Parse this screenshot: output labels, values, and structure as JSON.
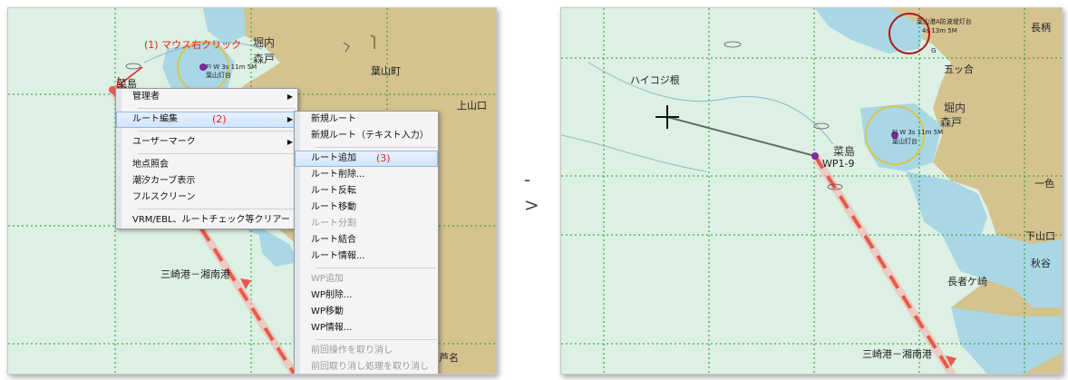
{
  "left_panel": {
    "annotations": {
      "step1": "(1) マウス右クリック",
      "step2": "(2)",
      "step3": "(3)"
    },
    "map_labels": {
      "horiuchi": "堀内",
      "morito": "森戸",
      "hayama": "葉山町",
      "najima": "菜島",
      "kamiyamaguchi": "上山口",
      "route_name": "三崎港－湘南港",
      "ashina": "芦名",
      "light_info": "Fl W 3s 11m 5M",
      "light_name": "葉山灯台"
    },
    "context_menu": {
      "items": [
        {
          "label": "管理者",
          "submenu": true
        },
        {
          "label": "ルート編集",
          "submenu": true
        },
        {
          "label": "ユーザーマーク",
          "submenu": true
        },
        {
          "label": "地点照会"
        },
        {
          "label": "潮汐カーブ表示"
        },
        {
          "label": "フルスクリーン"
        },
        {
          "label": "VRM/EBL、ルートチェック等クリアー"
        }
      ]
    },
    "submenu": {
      "items": [
        {
          "label": "新規ルート"
        },
        {
          "label": "新規ルート（テキスト入力）"
        },
        {
          "label": "ルート追加"
        },
        {
          "label": "ルート削除..."
        },
        {
          "label": "ルート反転"
        },
        {
          "label": "ルート移動"
        },
        {
          "label": "ルート分割",
          "disabled": true
        },
        {
          "label": "ルート結合"
        },
        {
          "label": "ルート情報..."
        },
        {
          "label": "WP追加",
          "disabled": true
        },
        {
          "label": "WP削除..."
        },
        {
          "label": "WP移動"
        },
        {
          "label": "WP情報..."
        },
        {
          "label": "前回操作を取り消し",
          "disabled": true
        },
        {
          "label": "前回取り消し処理を取り消し",
          "disabled": true
        }
      ]
    }
  },
  "separator_arrow": {
    "dash": "-",
    "gt": ">"
  },
  "right_panel": {
    "map_labels": {
      "haikojine": "ハイコジ根",
      "najima": "菜島",
      "waypoint": "WP1-9",
      "horiuchi": "堀内",
      "morito": "森戸",
      "gonotsuka": "五ッ合",
      "nagae": "長柄",
      "isshiki": "一色",
      "shimoyamaguchi": "下山口",
      "akiya": "秋谷",
      "nagajagasaki": "長者ケ崎",
      "route_name": "三崎港－湘南港",
      "light_info": "Fl W 3s 11m 5M",
      "light_name": "葉山灯台",
      "breakwater_light": "葉山港A防波堤灯台",
      "breakwater_info": "4s 13m 5M",
      "g_mark": "G"
    }
  },
  "colors": {
    "sea": "#dcf0e3",
    "land": "#d4c28f",
    "shallow": "#a9d7e6",
    "grid": "#1f9a2a",
    "route": "#e8594a",
    "annotation_red": "#e8201a",
    "menu_highlight": "#cfe3fb"
  }
}
